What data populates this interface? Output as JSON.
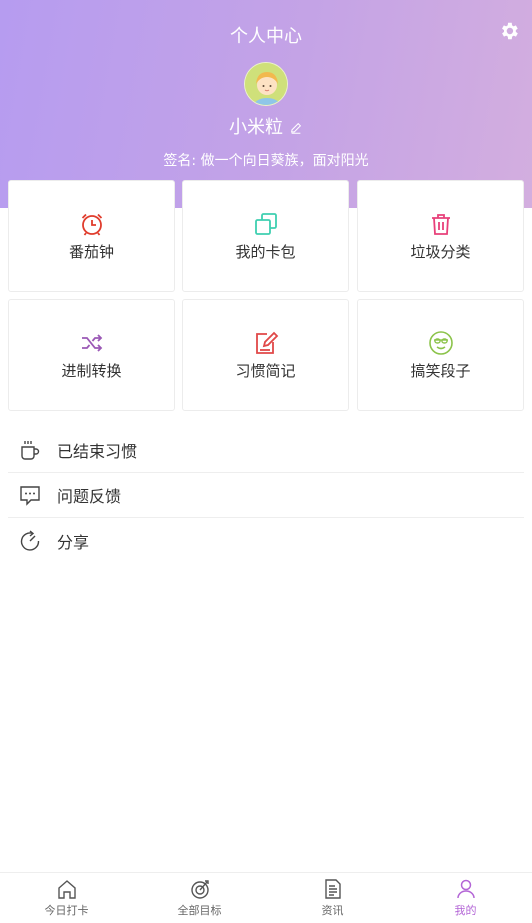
{
  "header": {
    "title": "个人中心",
    "username": "小米粒",
    "signature": "签名: 做一个向日葵族，面对阳光",
    "gradient_start": "#b69cf0",
    "gradient_end": "#d3aedf"
  },
  "grid": [
    {
      "label": "番茄钟",
      "icon": "alarm-clock-icon",
      "color": "#e03c2c"
    },
    {
      "label": "我的卡包",
      "icon": "card-stack-icon",
      "color": "#3ecfb0"
    },
    {
      "label": "垃圾分类",
      "icon": "trash-icon",
      "color": "#e8407a"
    },
    {
      "label": "进制转换",
      "icon": "shuffle-icon",
      "color": "#9b59b6"
    },
    {
      "label": "习惯简记",
      "icon": "note-edit-icon",
      "color": "#e04848"
    },
    {
      "label": "搞笑段子",
      "icon": "sunglasses-smile-icon",
      "color": "#8bc34a"
    }
  ],
  "list": [
    {
      "label": "已结束习惯",
      "icon": "cup-icon"
    },
    {
      "label": "问题反馈",
      "icon": "chat-bubble-icon"
    },
    {
      "label": "分享",
      "icon": "refresh-circle-icon"
    }
  ],
  "tabs": [
    {
      "label": "今日打卡",
      "icon": "home-icon",
      "active": false
    },
    {
      "label": "全部目标",
      "icon": "target-icon",
      "active": false
    },
    {
      "label": "资讯",
      "icon": "document-icon",
      "active": false
    },
    {
      "label": "我的",
      "icon": "user-icon",
      "active": true
    }
  ],
  "colors": {
    "accent": "#b365d6",
    "text": "#333333"
  }
}
